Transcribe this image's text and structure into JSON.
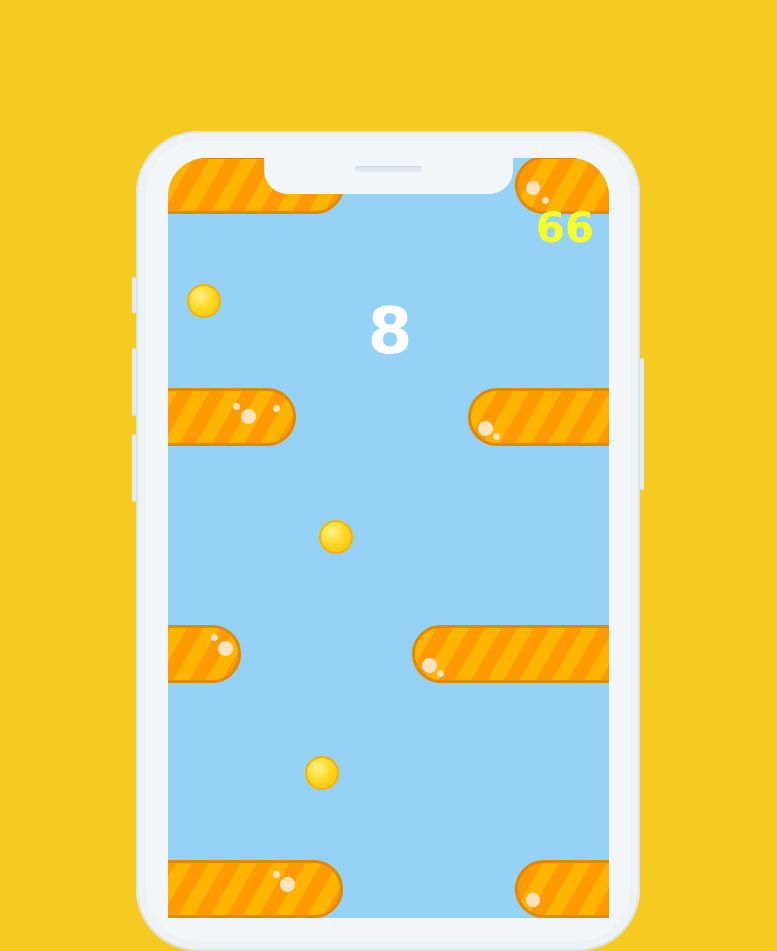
{
  "game": {
    "score": "8",
    "coin_count": "66"
  },
  "colors": {
    "background": "#f5cb22",
    "sky": "#96d2f5",
    "platform_stripe_a": "#ff9a00",
    "platform_stripe_b": "#ffb400",
    "coin": "#ffd61f",
    "score_text": "#ffffff",
    "coin_count_text": "#f7ff29"
  }
}
